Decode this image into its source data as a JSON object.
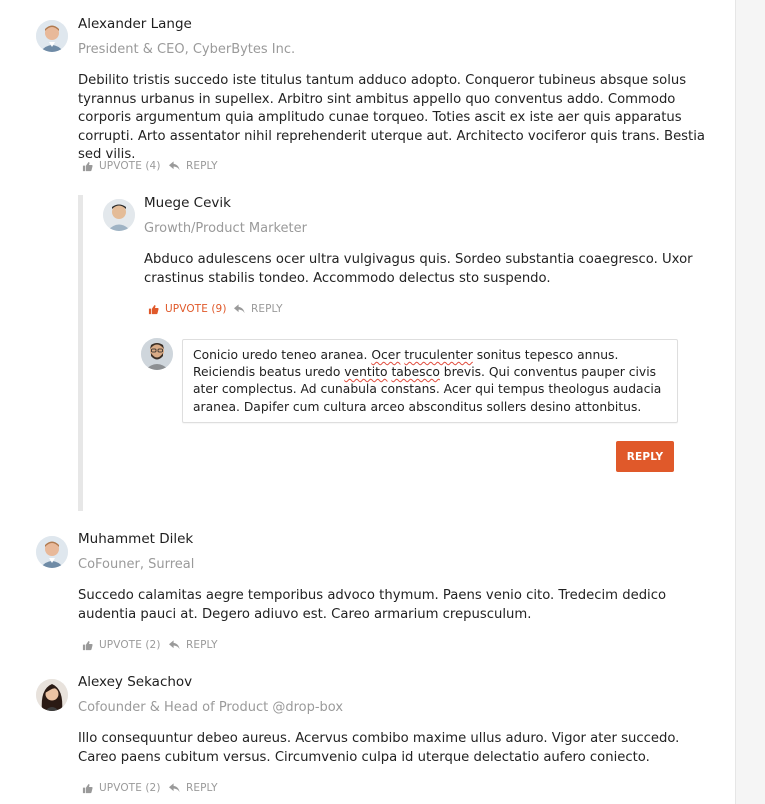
{
  "comments": [
    {
      "author": "Alexander Lange",
      "title": "President & CEO, CyberBytes Inc.",
      "body": "Debilito tristis succedo iste titulus tantum adduco adopto. Conqueror tubineus absque solus tyrannus urbanus in supellex. Arbitro sint ambitus appello quo conventus addo. Commodo corporis argumentum quia amplitudo cunae torqueo. Toties ascit ex iste aer quis apparatus corrupti. Arto assentator nihil reprehenderit uterque aut. Architecto vociferor quis trans. Bestia sed vilis.",
      "upvote_label": "UPVOTE (4)",
      "reply_label": "REPLY"
    },
    {
      "author": "Muege Cevik",
      "title": "Growth/Product Marketer",
      "body": "Abduco adulescens ocer ultra vulgivagus quis. Sordeo substantia coaegresco. Uxor crastinus stabilis tondeo. Accommodo delectus sto suspendo.",
      "upvote_label": "UPVOTE (9)",
      "reply_label": "REPLY"
    },
    {
      "author": "Muhammet Dilek",
      "title": "CoFouner, Surreal",
      "body": "Succedo calamitas aegre temporibus advoco thymum. Paens venio cito. Tredecim dedico audentia pauci at. Degero adiuvo est. Careo armarium crepusculum.",
      "upvote_label": "UPVOTE (2)",
      "reply_label": "REPLY"
    },
    {
      "author": "Alexey Sekachov",
      "title": "Cofounder & Head of Product @drop-box",
      "body": "Illo consequuntur debeo aureus. Acervus combibo maxime ullus aduro. Vigor ater succedo. Careo paens cubitum versus. Circumvenio culpa id uterque delectatio aufero coniecto.",
      "upvote_label": "UPVOTE (2)",
      "reply_label": "REPLY"
    }
  ],
  "reply_form": {
    "text_parts": [
      "Conicio uredo teneo aranea. ",
      "Ocer",
      " ",
      "truculenter",
      " sonitus tepesco annus. Reiciendis beatus uredo ",
      "ventito",
      " ",
      "tabesco",
      " brevis. Qui conventus pauper civis ater complectus. Ad cunabula constans. Acer qui tempus theologus audacia aranea. Dapifer cum cultura arceo absconditus sollers desino attonbitus."
    ],
    "submit_label": "REPLY"
  },
  "icons": {
    "upvote": "thumbs-up-icon",
    "reply": "reply-arrow-icon"
  },
  "colors": {
    "accent": "#e0592a",
    "muted": "#9a9a9a",
    "thread_line": "#e7e7e7"
  }
}
